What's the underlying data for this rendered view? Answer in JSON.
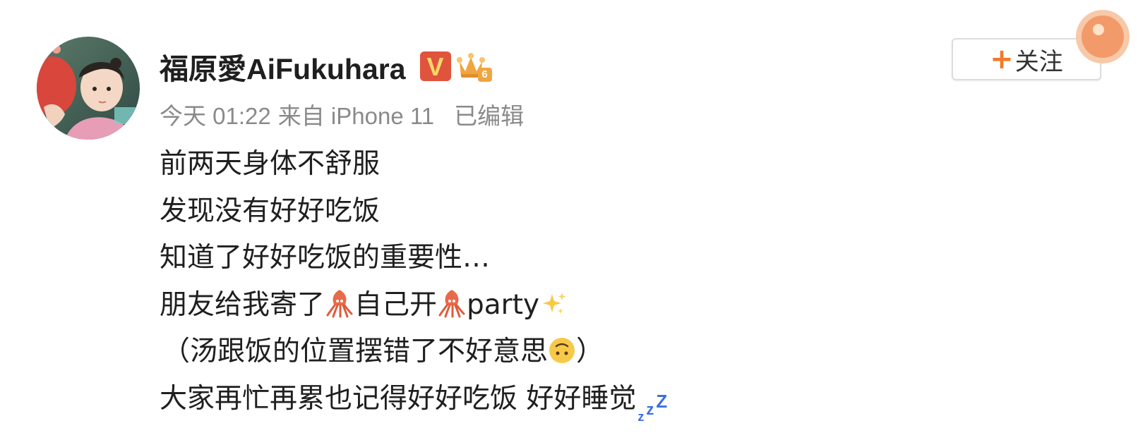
{
  "post": {
    "author": {
      "name": "福原愛AiFukuhara",
      "verified_badge": "V",
      "member_level": "6"
    },
    "meta": {
      "time": "今天 01:22",
      "source": "来自 iPhone 11",
      "edited": "已编辑"
    },
    "follow_button": {
      "icon": "+",
      "label": "关注",
      "accent_color": "#f07a2a"
    },
    "content": {
      "line1": "前两天身体不舒服",
      "line2": "发现没有好好吃饭",
      "line3": "知道了好好吃饭的重要性…",
      "line4": {
        "part1": "朋友给我寄了",
        "part2": "自己开",
        "part3": "party",
        "emoji1": "squid-emoji",
        "emoji2": "squid-emoji",
        "emoji3": "sparkles-emoji"
      },
      "line5": {
        "open_paren": "（",
        "text": "汤跟饭的位置摆错了不好意思",
        "close_paren": "）",
        "emoji": "upside-down-face-emoji"
      },
      "line6": {
        "text": "大家再忙再累也记得好好吃饭 好好睡觉",
        "emoji": "zzz-emoji"
      }
    },
    "colors": {
      "text": "#1f1f1f",
      "meta": "#8a8a8a",
      "verified": "#e0533c",
      "crown": "#f0a540",
      "zzz": "#3d6fe0"
    }
  }
}
